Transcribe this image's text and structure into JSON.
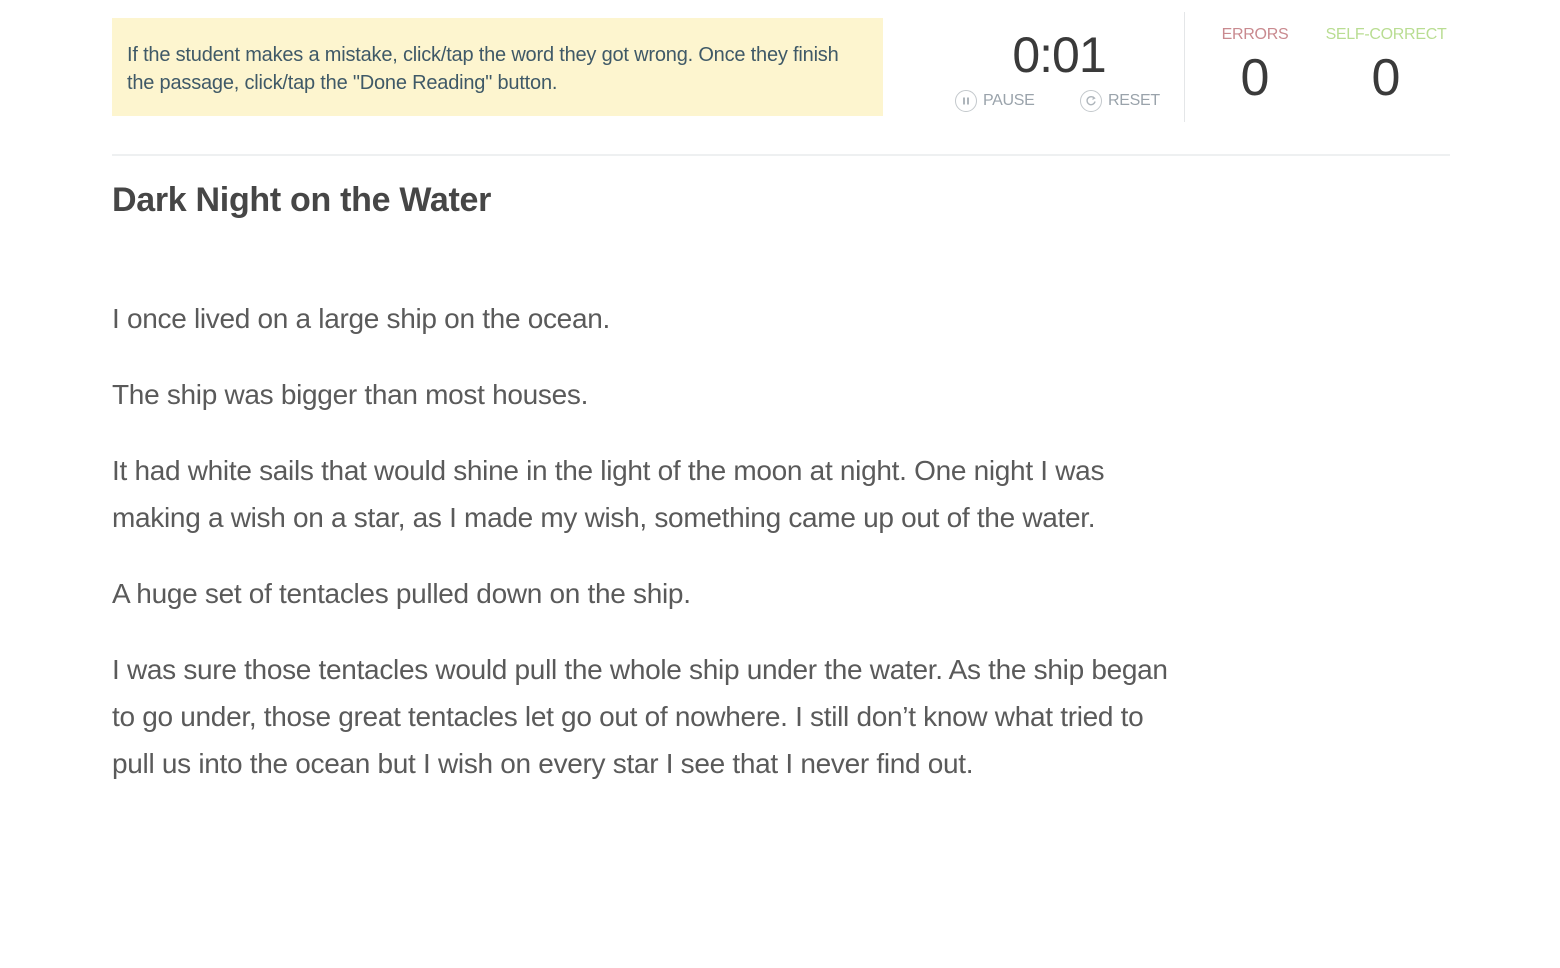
{
  "instructions": {
    "text": "If the student makes a mistake, click/tap the word they got wrong. Once they finish the passage, click/tap the \"Done Reading\" button."
  },
  "timer": {
    "value": "0:01",
    "pause_label": "PAUSE",
    "reset_label": "RESET"
  },
  "counters": {
    "errors": {
      "label": "ERRORS",
      "value": "0",
      "color": "#c98a8f"
    },
    "self_correct": {
      "label": "SELF-CORRECT",
      "value": "0",
      "color": "#b9dd92"
    }
  },
  "passage": {
    "title": "Dark Night on the Water",
    "paragraphs": [
      "I once lived on a large ship on the ocean.",
      "The ship was bigger than most houses.",
      "It had white sails that would shine in the light of the moon at night. One night I was making a wish on a star, as I made my wish, something came up out of the water.",
      "A huge set of tentacles pulled down on the ship.",
      "I was sure those tentacles would pull the whole ship under the water. As the ship began to go under, those great tentacles let go out of nowhere. I still don’t know what tried to pull us into the ocean but I wish on every star I see that I never find out."
    ]
  }
}
